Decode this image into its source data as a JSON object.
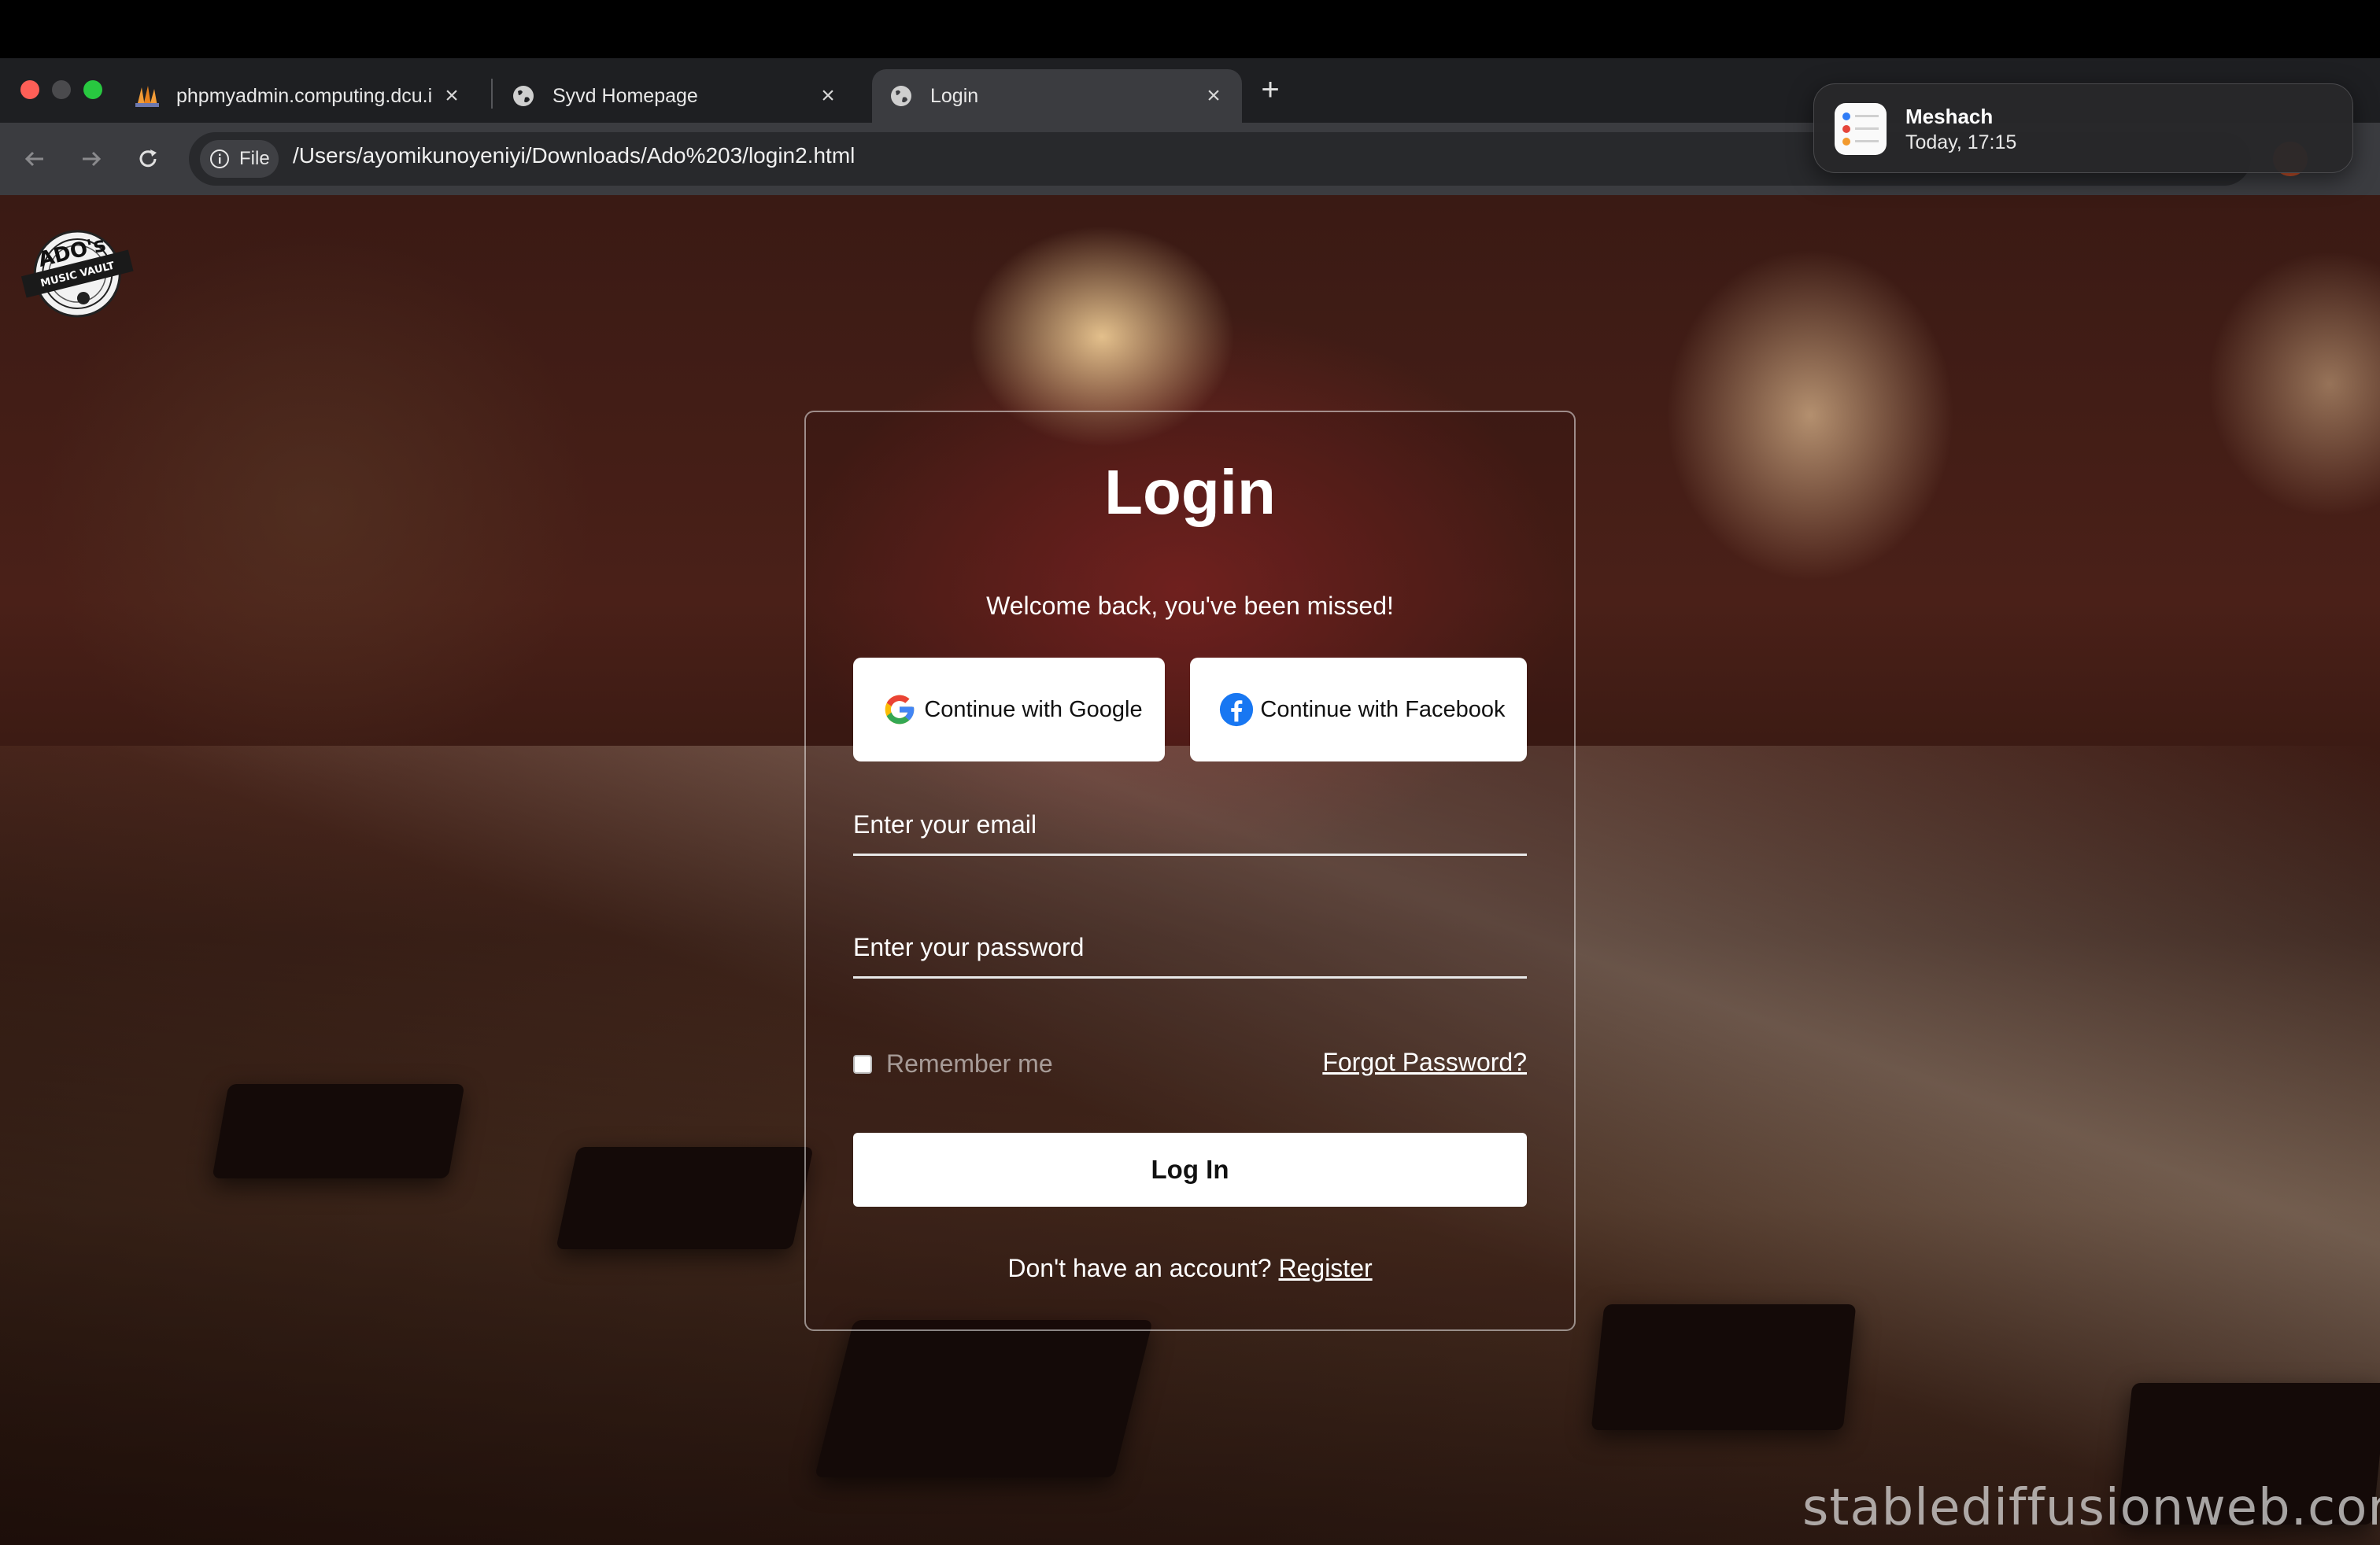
{
  "browser": {
    "tabs": [
      {
        "title": "phpmyadmin.computing.dcu.i",
        "icon": "phpmyadmin-icon"
      },
      {
        "title": "Syvd Homepage",
        "icon": "globe-icon"
      },
      {
        "title": "Login",
        "icon": "globe-icon",
        "active": true
      }
    ],
    "new_tab_label": "+",
    "close_label": "×",
    "address": {
      "chip_label": "File",
      "url": "/Users/ayomikunoyeniyi/Downloads/Ado%203/login2.html"
    }
  },
  "notification": {
    "title": "Meshach",
    "subtitle": "Today, 17:15",
    "icon": "reminders-icon"
  },
  "page": {
    "logo_text": "ADO's MUSIC VAULT",
    "watermark": "stablediffusionweb.com"
  },
  "login": {
    "title": "Login",
    "subtitle": "Welcome back, you've been missed!",
    "google_label": "Continue with Google",
    "facebook_label": "Continue with Facebook",
    "email_placeholder": "Enter your email",
    "password_placeholder": "Enter your password",
    "remember_label": "Remember me",
    "forgot_label": "Forgot Password?",
    "login_button": "Log In",
    "register_prompt": "Don't have an account?",
    "register_link": "Register"
  },
  "colors": {
    "google_blue": "#4285F4",
    "google_red": "#EA4335",
    "google_yellow": "#FBBC05",
    "google_green": "#34A853",
    "facebook_blue": "#1877F2"
  }
}
